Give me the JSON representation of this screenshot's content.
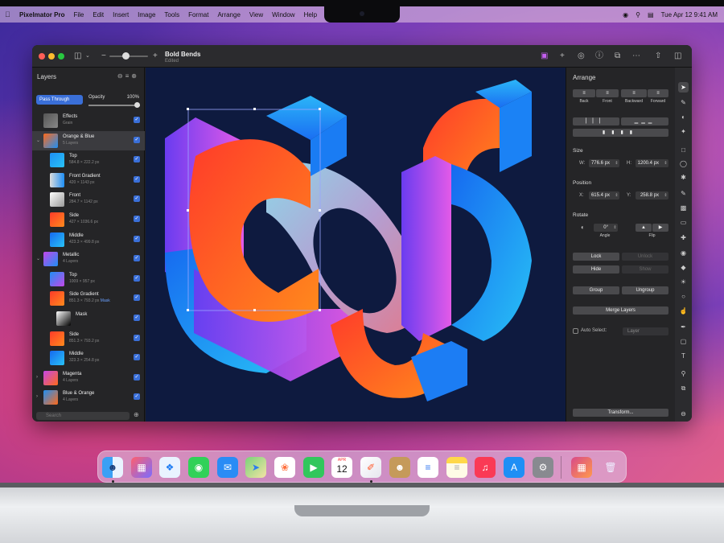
{
  "menubar": {
    "app": "Pixelmator Pro",
    "items": [
      "File",
      "Edit",
      "Insert",
      "Image",
      "Tools",
      "Format",
      "Arrange",
      "View",
      "Window",
      "Help"
    ],
    "clock": "Tue Apr 12  9:41 AM"
  },
  "document": {
    "title": "Bold Bends",
    "subtitle": "Edited"
  },
  "layers_panel": {
    "title": "Layers",
    "blend_mode": "Pass Through",
    "opacity_label": "Opacity",
    "opacity_value": "100%",
    "opacity_level": 1.0,
    "search_placeholder": "Search",
    "layers": [
      {
        "name": "Effects",
        "sub": "Grain",
        "indent": 0
      },
      {
        "name": "Orange & Blue",
        "sub": "5 Layers",
        "indent": 0,
        "group": true,
        "selected": true
      },
      {
        "name": "Top",
        "sub": "584.8 × 222.2 px",
        "indent": 1
      },
      {
        "name": "Front Gradient",
        "sub": "420 × 1143 px",
        "indent": 1
      },
      {
        "name": "Front",
        "sub": "284.7 × 1142 px",
        "indent": 1
      },
      {
        "name": "Side",
        "sub": "427 × 1036.6 px",
        "indent": 1
      },
      {
        "name": "Middle",
        "sub": "423.3 × 499.8 px",
        "indent": 1
      },
      {
        "name": "Metallic",
        "sub": "4 Layers",
        "indent": 0,
        "group": true
      },
      {
        "name": "Top",
        "sub": "1009 × 957 px",
        "indent": 1
      },
      {
        "name": "Side Gradient",
        "sub": "851.3 × 793.2 px",
        "mask": "Mask",
        "indent": 1
      },
      {
        "name": "Mask",
        "sub": "",
        "indent": 2
      },
      {
        "name": "Side",
        "sub": "851.3 × 793.2 px",
        "indent": 1
      },
      {
        "name": "Middle",
        "sub": "323.3 × 254.8 px",
        "indent": 1
      },
      {
        "name": "Magenta",
        "sub": "4 Layers",
        "indent": 0,
        "group": true
      },
      {
        "name": "Blue & Orange",
        "sub": "4 Layers",
        "indent": 0,
        "group": true
      }
    ]
  },
  "arrange_panel": {
    "title": "Arrange",
    "order_buttons": [
      "Back",
      "Front",
      "Backward",
      "Forward"
    ],
    "size_label": "Size",
    "w_label": "W:",
    "w_value": "776.6 px",
    "h_label": "H:",
    "h_value": "1200.4 px",
    "position_label": "Position",
    "x_label": "X:",
    "x_value": "615.4 px",
    "y_label": "Y:",
    "y_value": "258.8 px",
    "rotate_label": "Rotate",
    "angle_value": "0°",
    "angle_caption": "Angle",
    "flip_caption": "Flip",
    "lock": "Lock",
    "unlock": "Unlock",
    "hide": "Hide",
    "show": "Show",
    "group": "Group",
    "ungroup": "Ungroup",
    "merge": "Merge Layers",
    "auto_select": "Auto Select:",
    "auto_select_value": "Layer",
    "transform": "Transform..."
  },
  "dock": {
    "calendar_month": "APR",
    "calendar_day": "12",
    "apps": [
      "finder-icon",
      "launchpad-icon",
      "safari-icon",
      "messages-icon",
      "mail-icon",
      "maps-icon",
      "photos-icon",
      "facetime-icon",
      "calendar-icon",
      "pixelmator-icon",
      "contacts-icon",
      "reminders-icon",
      "notes-icon",
      "music-icon",
      "app-store-icon",
      "system-preferences-icon",
      "downloads-stack-icon",
      "trash-icon"
    ]
  },
  "colors": {
    "accent": "#3a6fd8",
    "canvas": "#0e1a3f",
    "orange": "#ff6a1a",
    "blue": "#1e8ff5",
    "magenta": "#c447e8"
  }
}
